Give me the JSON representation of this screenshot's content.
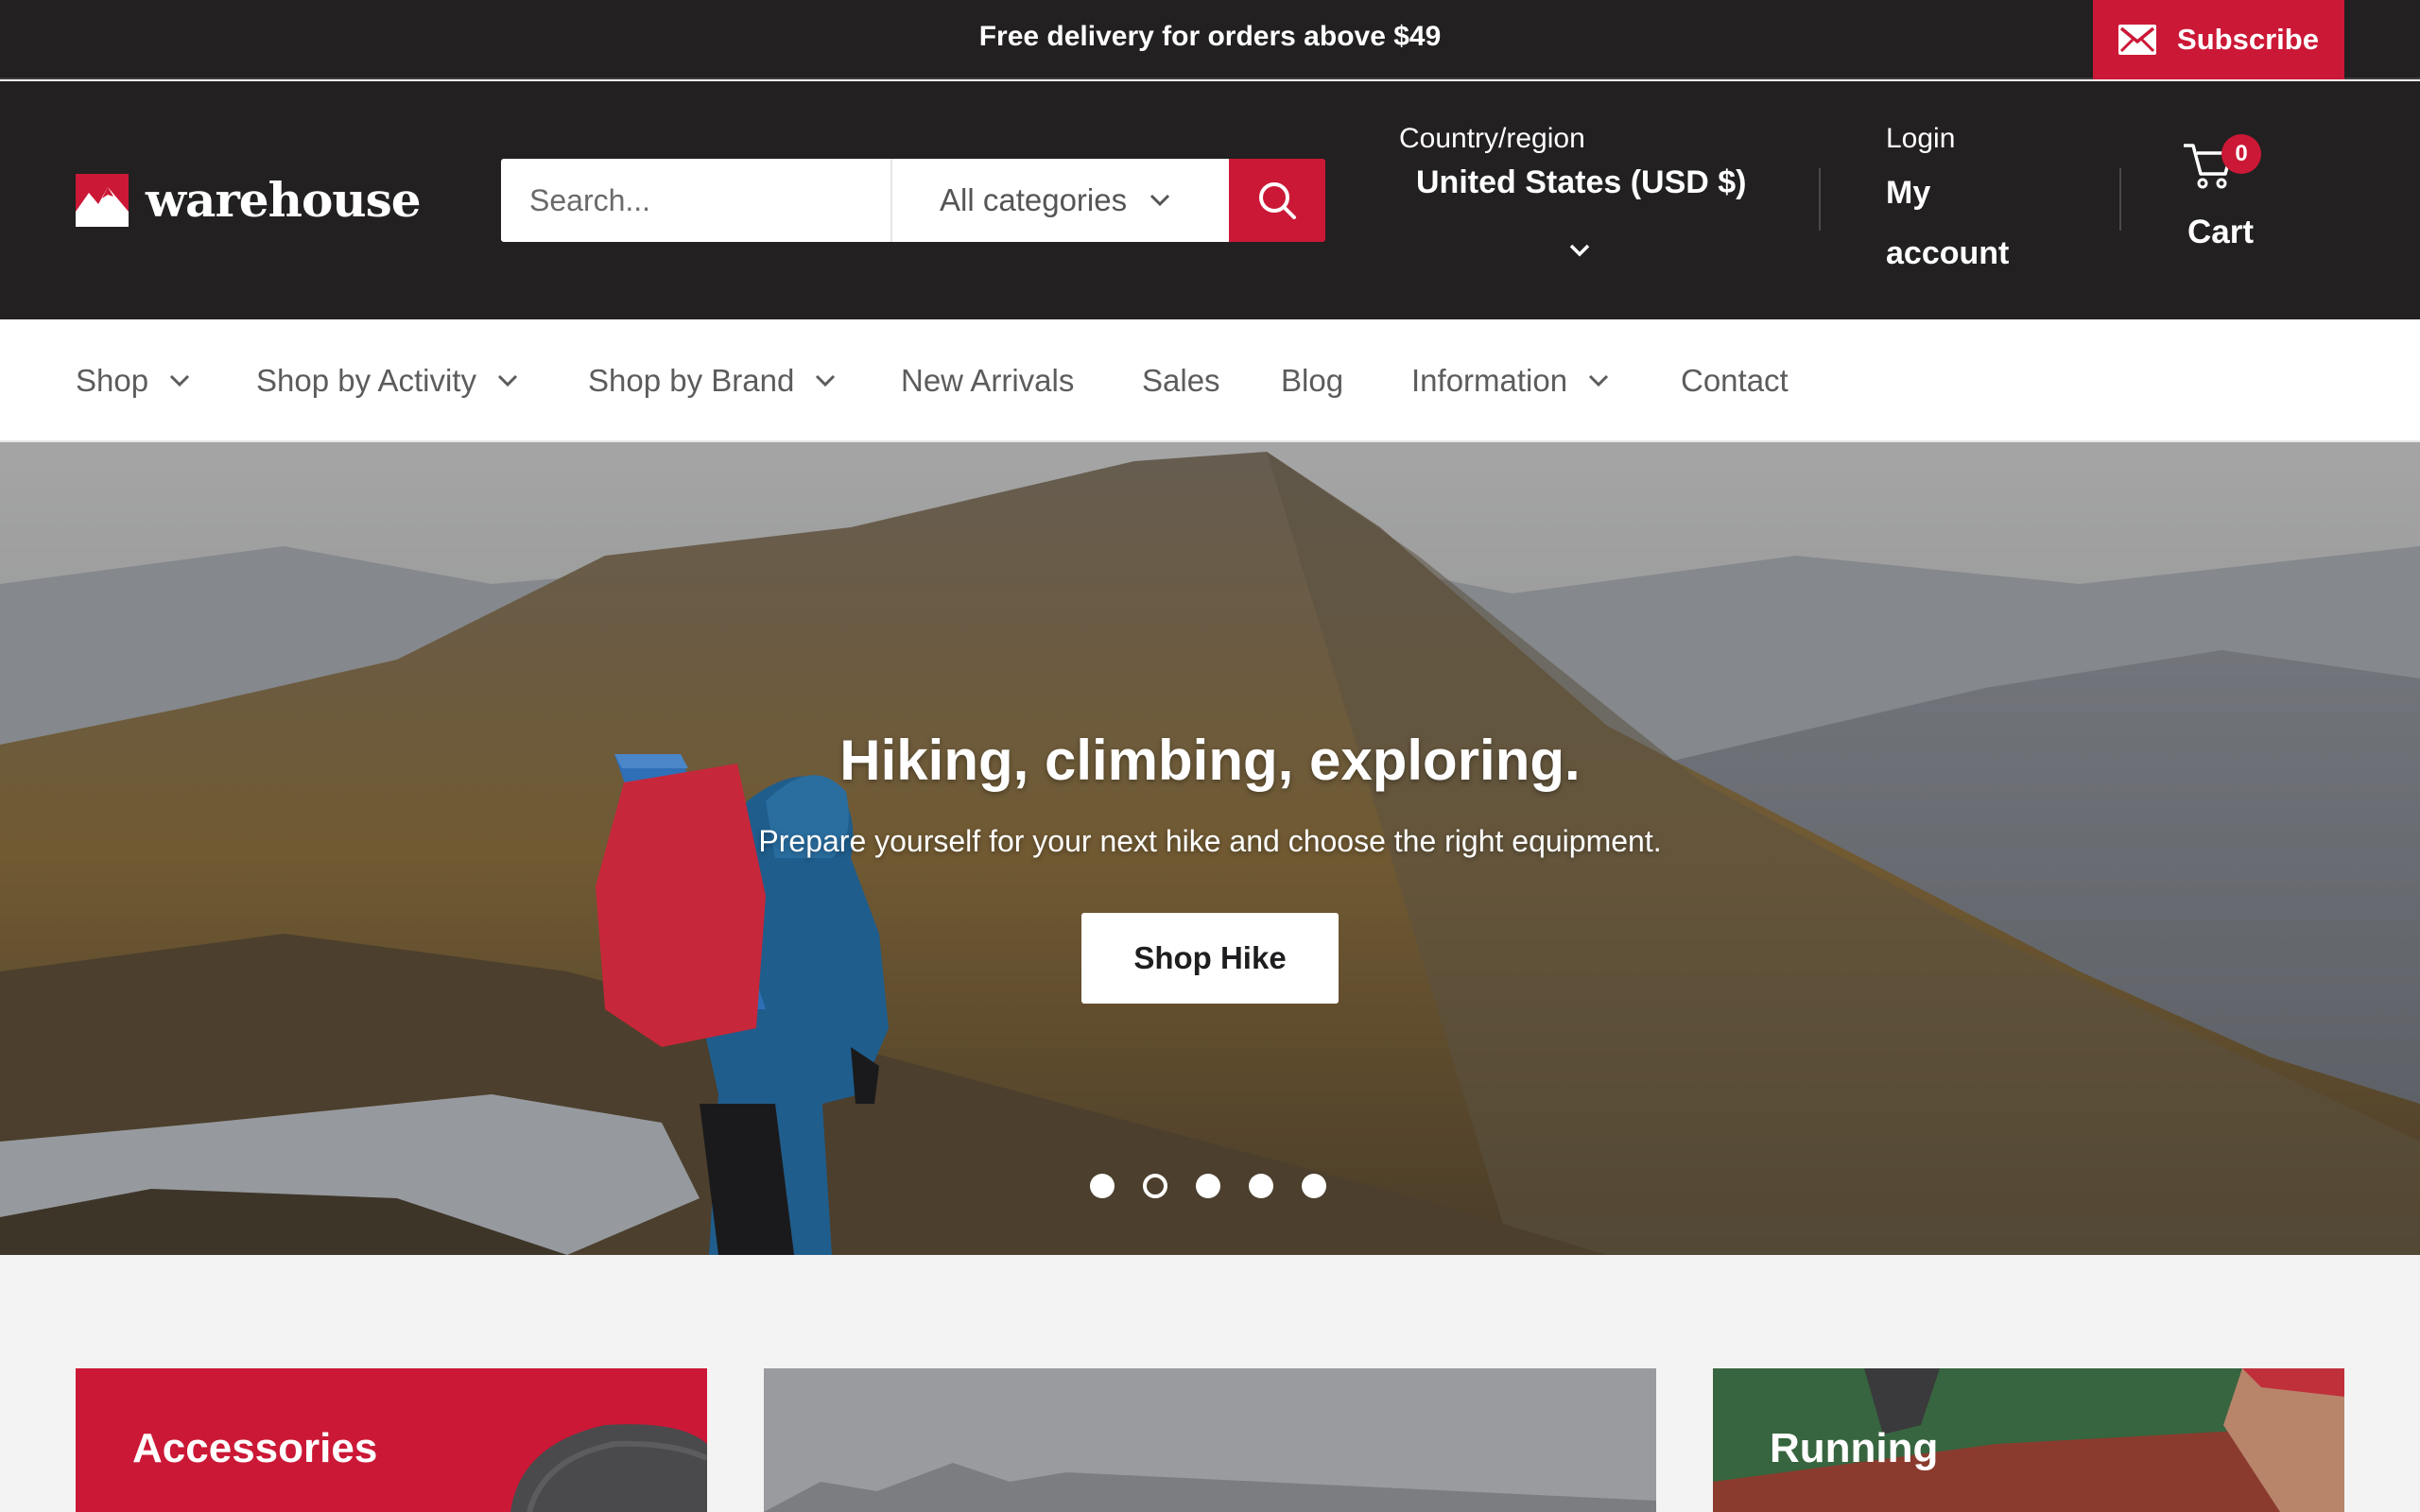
{
  "announcement": {
    "text": "Free delivery for orders above $49"
  },
  "subscribe": {
    "label": "Subscribe",
    "icon": "mail-icon"
  },
  "brand": {
    "name": "warehouse",
    "accent": "#cb1836",
    "dark": "#222021"
  },
  "search": {
    "placeholder": "Search...",
    "category": "All categories"
  },
  "country": {
    "label": "Country/region",
    "value": "United States (USD $)"
  },
  "account": {
    "label": "Login",
    "value": "My account"
  },
  "cart": {
    "label": "Cart",
    "count": "0"
  },
  "nav": {
    "items": [
      {
        "label": "Shop",
        "dropdown": true
      },
      {
        "label": "Shop by Activity",
        "dropdown": true
      },
      {
        "label": "Shop by Brand",
        "dropdown": true
      },
      {
        "label": "New Arrivals",
        "dropdown": false
      },
      {
        "label": "Sales",
        "dropdown": false
      },
      {
        "label": "Blog",
        "dropdown": false
      },
      {
        "label": "Information",
        "dropdown": true
      },
      {
        "label": "Contact",
        "dropdown": false
      }
    ]
  },
  "hero": {
    "title": "Hiking, climbing, exploring.",
    "subtitle": "Prepare yourself for your next hike and choose the right equipment.",
    "button": "Shop Hike",
    "slide_count": 5,
    "active_slide": 2
  },
  "collections": [
    {
      "title": "Accessories"
    },
    {
      "title": ""
    },
    {
      "title": "Running"
    }
  ]
}
